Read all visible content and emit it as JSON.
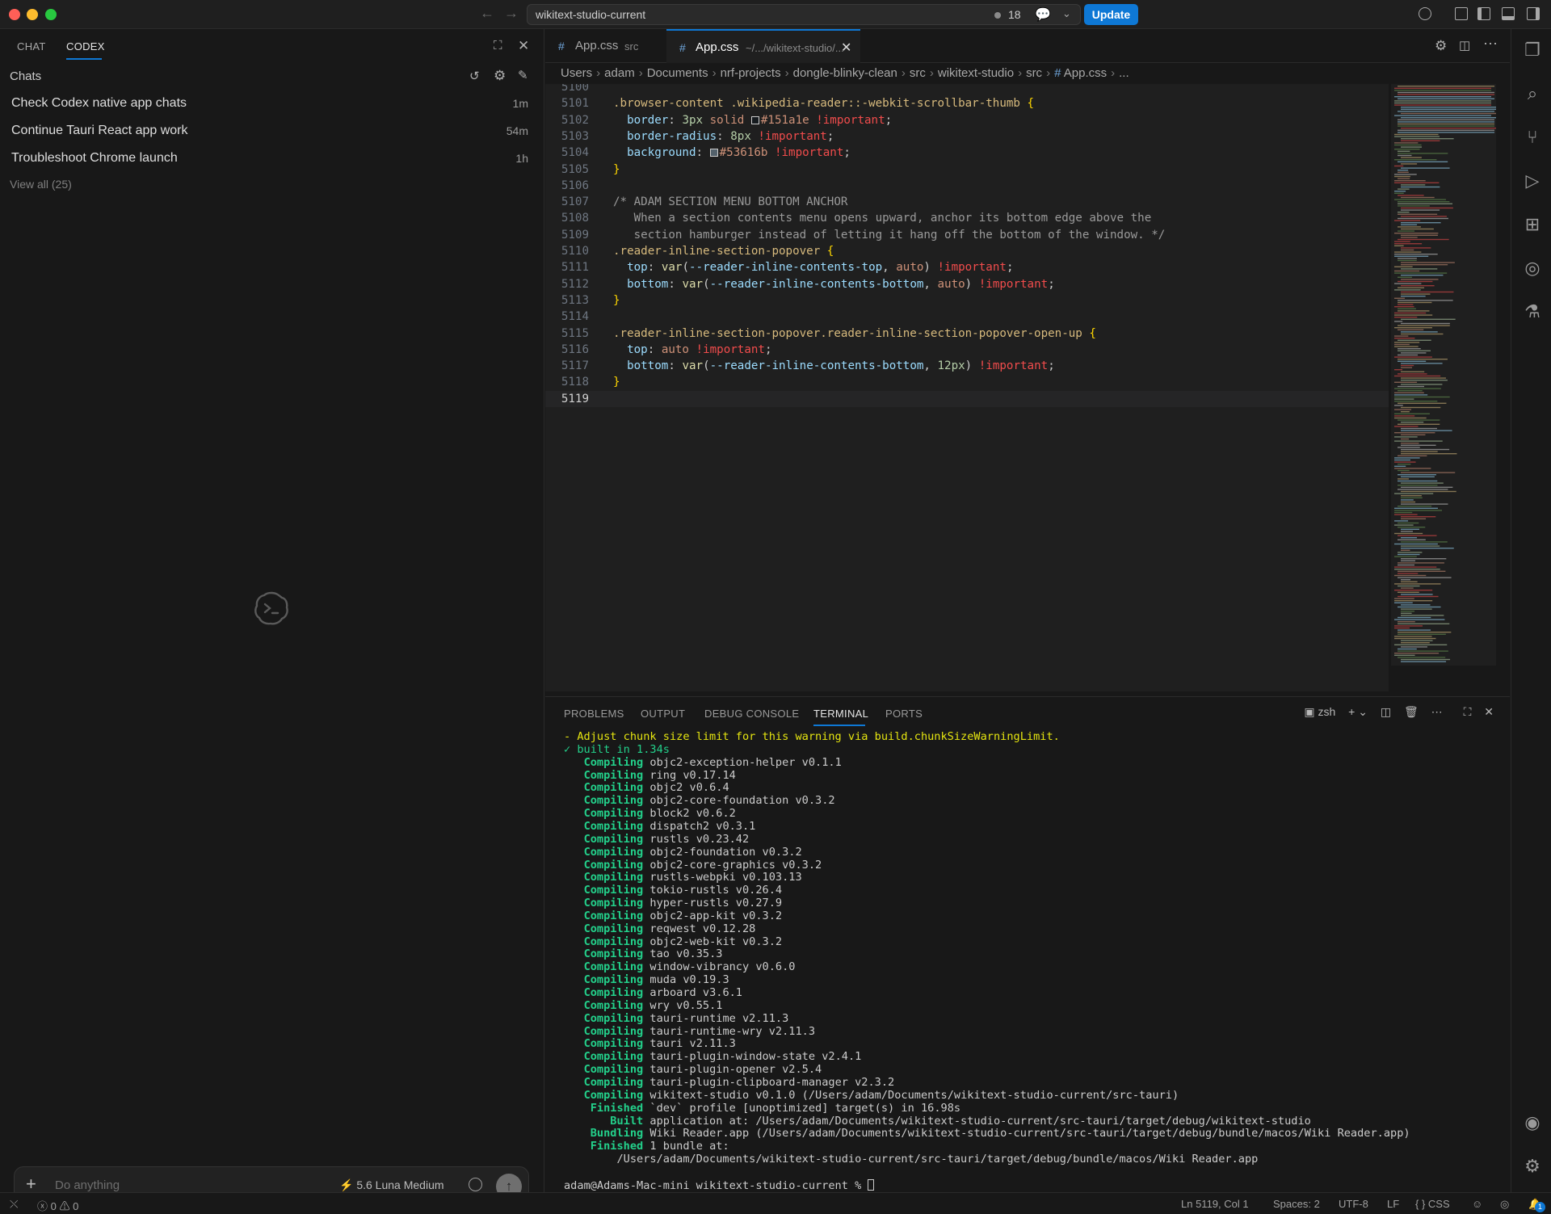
{
  "titlebar": {
    "window_title": "wikitext-studio-current",
    "notification_count": "18",
    "update_label": "Update"
  },
  "chat_panel": {
    "tabs": [
      "CHAT",
      "CODEX"
    ],
    "header": "Chats",
    "chats": [
      {
        "title": "Check Codex native app chats",
        "age": "1m"
      },
      {
        "title": "Continue Tauri React app work",
        "age": "54m"
      },
      {
        "title": "Troubleshoot Chrome launch",
        "age": "1h"
      }
    ],
    "view_all": "View all (25)",
    "composer": {
      "placeholder": "Do anything",
      "model": "5.6 Luna",
      "effort": "Medium"
    }
  },
  "editor": {
    "tabs": [
      {
        "name": "App.css",
        "desc": "src"
      },
      {
        "name": "App.css",
        "desc": "~/.../wikitext-studio/..."
      }
    ],
    "breadcrumb": [
      "Users",
      "adam",
      "Documents",
      "nrf-projects",
      "dongle-blinky-clean",
      "src",
      "wikitext-studio",
      "src",
      "App.css",
      "..."
    ],
    "lines": [
      {
        "n": "5100",
        "text": ""
      },
      {
        "n": "5101",
        "text": ".browser-content .wikipedia-reader::-webkit-scrollbar-thumb {"
      },
      {
        "n": "5102",
        "text": "  border: 3px solid #151a1e !important;"
      },
      {
        "n": "5103",
        "text": "  border-radius: 8px !important;"
      },
      {
        "n": "5104",
        "text": "  background: #53616b !important;"
      },
      {
        "n": "5105",
        "text": "}"
      },
      {
        "n": "5106",
        "text": ""
      },
      {
        "n": "5107",
        "text": "/* ADAM SECTION MENU BOTTOM ANCHOR"
      },
      {
        "n": "5108",
        "text": "   When a section contents menu opens upward, anchor its bottom edge above the"
      },
      {
        "n": "5109",
        "text": "   section hamburger instead of letting it hang off the bottom of the window. */"
      },
      {
        "n": "5110",
        "text": ".reader-inline-section-popover {"
      },
      {
        "n": "5111",
        "text": "  top: var(--reader-inline-contents-top, auto) !important;"
      },
      {
        "n": "5112",
        "text": "  bottom: var(--reader-inline-contents-bottom, auto) !important;"
      },
      {
        "n": "5113",
        "text": "}"
      },
      {
        "n": "5114",
        "text": ""
      },
      {
        "n": "5115",
        "text": ".reader-inline-section-popover.reader-inline-section-popover-open-up {"
      },
      {
        "n": "5116",
        "text": "  top: auto !important;"
      },
      {
        "n": "5117",
        "text": "  bottom: var(--reader-inline-contents-bottom, 12px) !important;"
      },
      {
        "n": "5118",
        "text": "}"
      },
      {
        "n": "5119",
        "text": ""
      }
    ]
  },
  "panel": {
    "tabs": [
      "PROBLEMS",
      "OUTPUT",
      "DEBUG CONSOLE",
      "TERMINAL",
      "PORTS"
    ],
    "shell": "zsh",
    "terminal": {
      "warning": "- Adjust chunk size limit for this warning via build.chunkSizeWarningLimit.",
      "built": "✓ built in 1.34s",
      "compiling": [
        "objc2-exception-helper v0.1.1",
        "ring v0.17.14",
        "objc2 v0.6.4",
        "objc2-core-foundation v0.3.2",
        "block2 v0.6.2",
        "dispatch2 v0.3.1",
        "rustls v0.23.42",
        "objc2-foundation v0.3.2",
        "objc2-core-graphics v0.3.2",
        "rustls-webpki v0.103.13",
        "tokio-rustls v0.26.4",
        "hyper-rustls v0.27.9",
        "objc2-app-kit v0.3.2",
        "reqwest v0.12.28",
        "objc2-web-kit v0.3.2",
        "tao v0.35.3",
        "window-vibrancy v0.6.0",
        "muda v0.19.3",
        "arboard v3.6.1",
        "wry v0.55.1",
        "tauri-runtime v2.11.3",
        "tauri-runtime-wry v2.11.3",
        "tauri v2.11.3",
        "tauri-plugin-window-state v2.4.1",
        "tauri-plugin-opener v2.5.4",
        "tauri-plugin-clipboard-manager v2.3.2",
        "wikitext-studio v0.1.0 (/Users/adam/Documents/wikitext-studio-current/src-tauri)"
      ],
      "compiling_word": "Compiling",
      "finished_word": "Finished",
      "finished_text": "`dev` profile [unoptimized] target(s) in 16.98s",
      "built_word": "Built",
      "built_text": "application at: /Users/adam/Documents/wikitext-studio-current/src-tauri/target/debug/wikitext-studio",
      "bundling_word": "Bundling",
      "bundling_text": "Wiki Reader.app (/Users/adam/Documents/wikitext-studio-current/src-tauri/target/debug/bundle/macos/Wiki Reader.app)",
      "finished2_text": "1 bundle at:",
      "bundle_path": "/Users/adam/Documents/wikitext-studio-current/src-tauri/target/debug/bundle/macos/Wiki Reader.app",
      "prompt": "adam@Adams-Mac-mini wikitext-studio-current % "
    }
  },
  "statusbar": {
    "errors": "0",
    "warnings": "0",
    "position": "Ln 5119, Col 1",
    "spaces": "Spaces: 2",
    "encoding": "UTF-8",
    "eol": "LF",
    "language": "CSS",
    "bell_count": "1"
  },
  "colors": {
    "accent": "#0e78d5",
    "terminal_green": "#23d18b",
    "terminal_yellow": "#e5e510",
    "swatch_1": "#151a1e",
    "swatch_2": "#53616b"
  }
}
